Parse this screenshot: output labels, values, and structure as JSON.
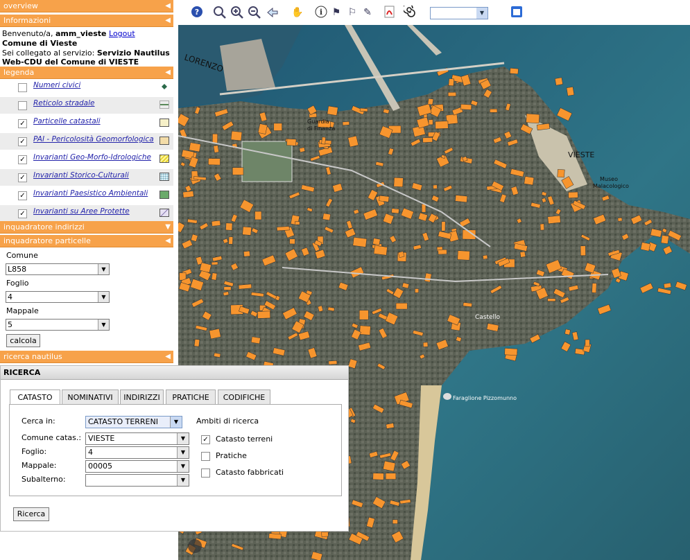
{
  "sidebar": {
    "overview": "overview",
    "informazioni": "Informazioni",
    "welcome_prefix": "Benvenuto/a,",
    "username": "amm_vieste",
    "logout": "Logout",
    "comune": "Comune di Vieste",
    "service_prefix": "Sei collegato al servizio:",
    "service_name_1": "Servizio Nautilus",
    "service_name_2": "Web-CDU del Comune di VIESTE",
    "legenda": "legenda",
    "layers": [
      {
        "label": "Numeri civici",
        "checked": false,
        "symbol": "dot"
      },
      {
        "label": "Reticolo stradale",
        "checked": false,
        "symbol": "line"
      },
      {
        "label": "Particelle catastali",
        "checked": true,
        "symbol": "#f6f0c8"
      },
      {
        "label": "PAI - Pericolosità Geomorfologica",
        "checked": true,
        "symbol": "#f3dca8"
      },
      {
        "label": "Invarianti Geo-Morfo-Idrologiche",
        "checked": true,
        "symbol": "hatch-yellow"
      },
      {
        "label": "Invarianti Storico-Culturali",
        "checked": true,
        "symbol": "#d8eef6"
      },
      {
        "label": "Invarianti Paesistico Ambientali",
        "checked": true,
        "symbol": "#6aaa6a"
      },
      {
        "label": "Invarianti su Aree Protette",
        "checked": true,
        "symbol": "hatch-purple"
      }
    ],
    "inquadratore_indirizzi": "inquadratore indirizzi",
    "inquadratore_particelle": "inquadratore particelle",
    "comune_label": "Comune",
    "comune_value": "L858",
    "foglio_label": "Foglio",
    "foglio_value": "4",
    "mappale_label": "Mappale",
    "mappale_value": "5",
    "calcola": "calcola",
    "ricerca_nautilus": "ricerca nautilus"
  },
  "map": {
    "labels": {
      "lorenzo": "LORENZO",
      "guardia": "Guardia\ndi Finanza",
      "vieste": "VIESTE",
      "museo": "Museo\nMalacologico",
      "castello": "Castello",
      "pizzomunno": "Faraglione Pizzomunno"
    }
  },
  "dialog": {
    "title": "RICERCA",
    "tabs": [
      "CATASTO",
      "NOMINATIVI",
      "INDIRIZZI",
      "PRATICHE",
      "CODIFICHE"
    ],
    "cerca_in_label": "Cerca in:",
    "cerca_in_value": "CATASTO TERRENI",
    "comune_label": "Comune catas.:",
    "comune_value": "VIESTE",
    "foglio_label": "Foglio:",
    "foglio_value": "4",
    "mappale_label": "Mappale:",
    "mappale_value": "00005",
    "subalterno_label": "Subalterno:",
    "subalterno_value": "",
    "ambiti_label": "Ambiti di ricerca",
    "ambiti": [
      {
        "label": "Catasto terreni",
        "checked": true
      },
      {
        "label": "Pratiche",
        "checked": false
      },
      {
        "label": "Catasto fabbricati",
        "checked": false
      }
    ],
    "ricerca_button": "Ricerca"
  },
  "colors": {
    "header_orange": "#f7a24a",
    "building_orange": "#f7952e",
    "sea": "#2e6b82"
  }
}
